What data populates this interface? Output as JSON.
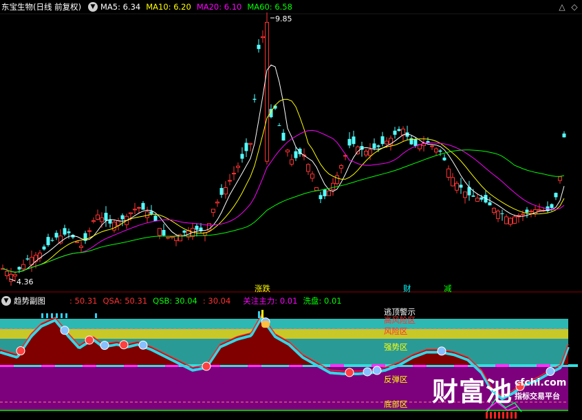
{
  "main_panel": {
    "stock_name": "东宝生物",
    "period": "(日线 前复权)",
    "ma_items": [
      {
        "label": "MA5: 6.34",
        "color": "#ffffff"
      },
      {
        "label": "MA10: 6.20",
        "color": "#ffff00"
      },
      {
        "label": "MA20: 6.10",
        "color": "#ff00ff"
      },
      {
        "label": "MA60: 6.58",
        "color": "#00ff00"
      }
    ],
    "high_label": "9.85",
    "low_label": "4.36",
    "markers": [
      {
        "text": "涨跌",
        "color": "#ffff00"
      },
      {
        "text": "财",
        "color": "#00ffff"
      },
      {
        "text": "减",
        "color": "#00ff00"
      }
    ]
  },
  "sub_panel": {
    "title": "趋势副图",
    "indicators": [
      {
        "label": ": 50.31",
        "color": "#ff3030"
      },
      {
        "label": "QSA: 50.31",
        "color": "#ff3030"
      },
      {
        "label": "QSB: 30.04",
        "color": "#00ff00"
      },
      {
        "label": ": 30.04",
        "color": "#ff3030"
      },
      {
        "label": "关注主力: 0.01",
        "color": "#ff00ff"
      },
      {
        "label": "洗盘: 0.01",
        "color": "#00ff00"
      }
    ],
    "zones": [
      {
        "label": "高风险区",
        "color": "#ff3030"
      },
      {
        "label": "风险区",
        "color": "#ff3030"
      },
      {
        "label": "强势区",
        "color": "#ffff00"
      },
      {
        "label": "反弹区",
        "color": "#ffff00"
      },
      {
        "label": "底部区",
        "color": "#ffff00"
      },
      {
        "label": "逃顶警示",
        "color": "#ffffff"
      }
    ]
  },
  "watermark": {
    "brand": "财富池",
    "site": "cfchi.com",
    "slogan": "指标交易平台"
  },
  "chart_data": {
    "type": "candlestick",
    "y_high": 9.85,
    "y_low": 4.36,
    "price_pivots": [
      [
        0,
        4.6
      ],
      [
        20,
        4.4
      ],
      [
        40,
        4.75
      ],
      [
        60,
        4.9
      ],
      [
        80,
        5.2
      ],
      [
        100,
        5.3
      ],
      [
        120,
        5.0
      ],
      [
        140,
        5.7
      ],
      [
        160,
        5.5
      ],
      [
        180,
        5.6
      ],
      [
        200,
        5.85
      ],
      [
        220,
        5.7
      ],
      [
        240,
        5.2
      ],
      [
        260,
        5.25
      ],
      [
        280,
        5.4
      ],
      [
        300,
        5.3
      ],
      [
        310,
        5.8
      ],
      [
        330,
        6.3
      ],
      [
        350,
        6.8
      ],
      [
        365,
        7.2
      ],
      [
        380,
        9.85
      ],
      [
        390,
        7.6
      ],
      [
        400,
        7.9
      ],
      [
        410,
        7.3
      ],
      [
        425,
        6.8
      ],
      [
        440,
        7.0
      ],
      [
        455,
        6.5
      ],
      [
        465,
        6.0
      ],
      [
        475,
        6.1
      ],
      [
        490,
        6.5
      ],
      [
        510,
        7.2
      ],
      [
        530,
        7.0
      ],
      [
        550,
        7.1
      ],
      [
        570,
        7.3
      ],
      [
        585,
        7.5
      ],
      [
        600,
        7.1
      ],
      [
        620,
        7.2
      ],
      [
        640,
        7.0
      ],
      [
        660,
        6.4
      ],
      [
        680,
        6.1
      ],
      [
        700,
        6.0
      ],
      [
        720,
        5.8
      ],
      [
        740,
        5.6
      ],
      [
        760,
        5.7
      ],
      [
        780,
        5.8
      ],
      [
        800,
        5.75
      ],
      [
        812,
        6.2
      ],
      [
        820,
        7.3
      ]
    ],
    "subchart_pivots": [
      [
        0,
        30
      ],
      [
        25,
        20
      ],
      [
        45,
        60
      ],
      [
        60,
        80
      ],
      [
        80,
        92
      ],
      [
        100,
        60
      ],
      [
        115,
        38
      ],
      [
        135,
        55
      ],
      [
        150,
        40
      ],
      [
        170,
        45
      ],
      [
        185,
        40
      ],
      [
        200,
        45
      ],
      [
        220,
        35
      ],
      [
        250,
        15
      ],
      [
        280,
        -5
      ],
      [
        300,
        0
      ],
      [
        320,
        40
      ],
      [
        345,
        55
      ],
      [
        365,
        62
      ],
      [
        380,
        97
      ],
      [
        400,
        60
      ],
      [
        420,
        45
      ],
      [
        440,
        20
      ],
      [
        460,
        5
      ],
      [
        480,
        -10
      ],
      [
        500,
        -12
      ],
      [
        520,
        -12
      ],
      [
        540,
        -10
      ],
      [
        560,
        -5
      ],
      [
        580,
        5
      ],
      [
        600,
        20
      ],
      [
        620,
        30
      ],
      [
        640,
        30
      ],
      [
        660,
        25
      ],
      [
        680,
        15
      ],
      [
        700,
        -10
      ],
      [
        715,
        -45
      ],
      [
        730,
        -60
      ],
      [
        745,
        -50
      ],
      [
        760,
        -35
      ],
      [
        780,
        -25
      ],
      [
        800,
        -10
      ],
      [
        815,
        0
      ],
      [
        826,
        40
      ]
    ]
  }
}
